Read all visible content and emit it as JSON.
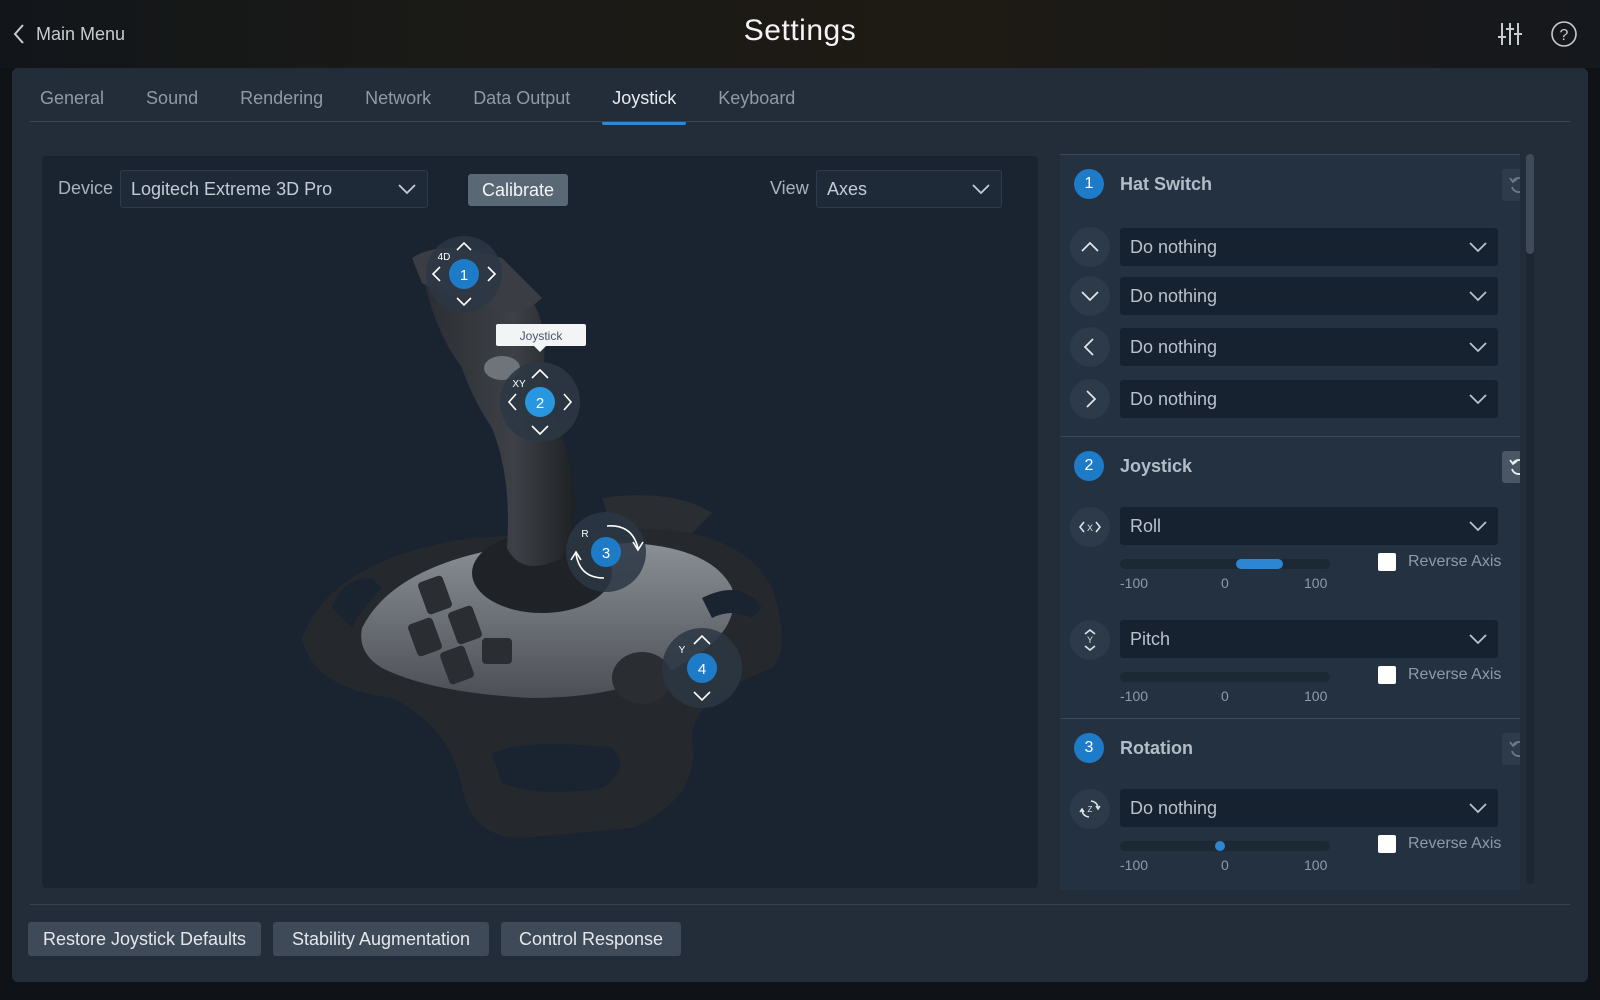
{
  "header": {
    "back_label": "Main Menu",
    "title": "Settings"
  },
  "tabs": [
    {
      "label": "General"
    },
    {
      "label": "Sound"
    },
    {
      "label": "Rendering"
    },
    {
      "label": "Network"
    },
    {
      "label": "Data Output"
    },
    {
      "label": "Joystick",
      "active": true
    },
    {
      "label": "Keyboard"
    }
  ],
  "device": {
    "label": "Device",
    "value": "Logitech Extreme 3D Pro",
    "calibrate": "Calibrate",
    "view_label": "View",
    "view_value": "Axes"
  },
  "hotspots": {
    "hat": {
      "num": "1",
      "tag": "4D"
    },
    "stick": {
      "num": "2",
      "tag": "XY",
      "tooltip": "Joystick"
    },
    "twist": {
      "num": "3",
      "tag": "R"
    },
    "throttle": {
      "num": "4",
      "tag": "Y"
    }
  },
  "sections": {
    "hat": {
      "num": "1",
      "title": "Hat Switch",
      "rows": [
        {
          "dir": "up",
          "value": "Do nothing"
        },
        {
          "dir": "down",
          "value": "Do nothing"
        },
        {
          "dir": "left",
          "value": "Do nothing"
        },
        {
          "dir": "right",
          "value": "Do nothing"
        }
      ]
    },
    "joystick": {
      "num": "2",
      "title": "Joystick",
      "axes": [
        {
          "axis": "X",
          "value": "Roll",
          "level_from": 0.1,
          "level_to": 0.55,
          "reverse": "Reverse Axis"
        },
        {
          "axis": "Y",
          "value": "Pitch",
          "level_from": 0,
          "level_to": 0,
          "reverse": "Reverse Axis"
        }
      ]
    },
    "rotation": {
      "num": "3",
      "title": "Rotation",
      "axes": [
        {
          "axis": "Z",
          "value": "Do nothing",
          "level_from": -0.1,
          "level_to": 0,
          "reverse": "Reverse Axis"
        }
      ]
    }
  },
  "scale": {
    "min": "-100",
    "mid": "0",
    "max": "100"
  },
  "footer": {
    "restore": "Restore Joystick Defaults",
    "stability": "Stability Augmentation",
    "control": "Control Response"
  },
  "colors": {
    "accent": "#2b8ad8",
    "badge": "#1d7bc8"
  }
}
